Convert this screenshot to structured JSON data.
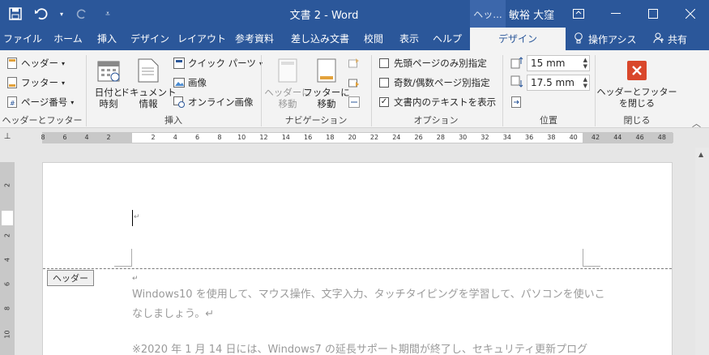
{
  "title_bar": {
    "doc_title": "文書 2  -  Word",
    "context_title": "ヘッ...",
    "user": "敏裕 大窪"
  },
  "tabs": [
    {
      "label": "ファイル"
    },
    {
      "label": "ホーム"
    },
    {
      "label": "挿入"
    },
    {
      "label": "デザイン"
    },
    {
      "label": "レイアウト"
    },
    {
      "label": "参考資料"
    },
    {
      "label": "差し込み文書"
    },
    {
      "label": "校閲"
    },
    {
      "label": "表示"
    },
    {
      "label": "ヘルプ"
    },
    {
      "label": "デザイン"
    }
  ],
  "tell_me": "操作アシス",
  "share": "共有",
  "ribbon": {
    "header_footer": {
      "header": "ヘッダー",
      "footer": "フッター",
      "page_number": "ページ番号",
      "label": "ヘッダーとフッター"
    },
    "insert": {
      "date_time": "日付と\n時刻",
      "doc_info": "ドキュメント\n情報",
      "quick_parts": "クイック パーツ",
      "picture": "画像",
      "online_picture": "オンライン画像",
      "label": "挿入"
    },
    "navigation": {
      "go_header": "ヘッダーに\n移動",
      "go_footer": "フッターに\n移動",
      "label": "ナビゲーション"
    },
    "options": {
      "first_page": "先頭ページのみ別指定",
      "odd_even": "奇数/偶数ページ別指定",
      "show_text": "文書内のテキストを表示",
      "show_text_checked": true,
      "label": "オプション"
    },
    "position": {
      "header_pos": "15 mm",
      "footer_pos": "17.5 mm",
      "label": "位置"
    },
    "close": {
      "close_btn": "ヘッダーとフッター\nを閉じる",
      "label": "閉じる"
    }
  },
  "ruler": {
    "left_numbers": [
      "8",
      "6",
      "4",
      "2"
    ],
    "numbers": [
      "2",
      "4",
      "6",
      "8",
      "10",
      "12",
      "14",
      "16",
      "18",
      "20",
      "22",
      "24",
      "26",
      "28",
      "30",
      "32",
      "34",
      "36",
      "38",
      "40",
      "42",
      "44",
      "46",
      "48"
    ]
  },
  "vruler": [
    "2",
    "2",
    "4",
    "6",
    "8",
    "10"
  ],
  "document": {
    "header_tag": "ヘッダー",
    "line1": "Windows10 を使用して、マウス操作、文字入力、タッチタイピングを学習して、パソコンを使いこ",
    "line2": "なしましょう。↵",
    "line3": "※2020 年 1 月 14 日には、Windows7 の延長サポート期間が終了し、セキュリティ更新プログ"
  }
}
